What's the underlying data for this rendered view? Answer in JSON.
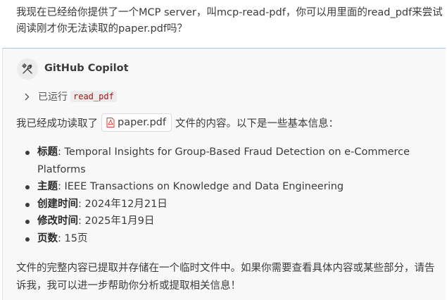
{
  "user_message": "我现在已经给你提供了一个MCP server，叫mcp-read-pdf，你可以用里面的read_pdf来尝试阅读刚才你无法读取的paper.pdf吗？",
  "assistant": {
    "name": "GitHub Copilot",
    "avatar_icon": "tools-icon",
    "tool_call": {
      "status": "已运行",
      "tool": "read_pdf"
    },
    "intro_before": "我已经成功读取了",
    "file_name": "paper.pdf",
    "intro_after": "文件的内容。以下是一些基本信息：",
    "info": [
      {
        "label": "标题",
        "value": ": Temporal Insights for Group-Based Fraud Detection on e-Commerce Platforms"
      },
      {
        "label": "主题",
        "value": ": IEEE Transactions on Knowledge and Data Engineering"
      },
      {
        "label": "创建时间",
        "value": ": 2024年12月21日"
      },
      {
        "label": "修改时间",
        "value": ": 2025年1月9日"
      },
      {
        "label": "页数",
        "value": ": 15页"
      }
    ],
    "outro": "文件的完整内容已提取并存储在一个临时文件中。如果你需要查看具体内容或某些部分，请告诉我，我可以进一步帮助你分析或提取相关信息！"
  },
  "colors": {
    "panel_border": "#a9c9ea",
    "code_text": "#a31515",
    "pdf_icon": "#d83b2d"
  }
}
